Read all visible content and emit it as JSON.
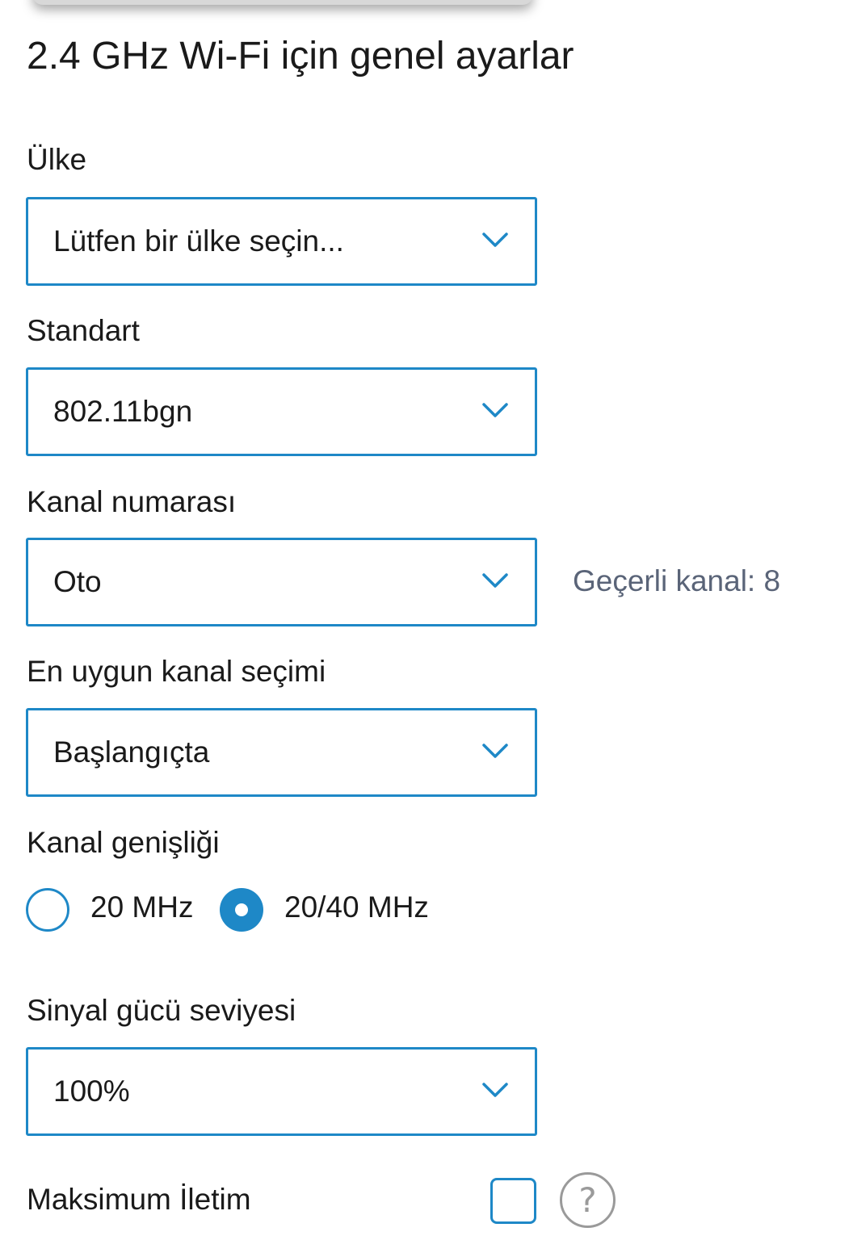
{
  "page": {
    "title": "2.4 GHz Wi-Fi için genel ayarlar"
  },
  "country": {
    "label": "Ülke",
    "value": "Lütfen bir ülke seçin...",
    "icon": "chevron-down-icon"
  },
  "standard": {
    "label": "Standart",
    "value": "802.11bgn",
    "icon": "chevron-down-icon"
  },
  "channel_number": {
    "label": "Kanal numarası",
    "value": "Oto",
    "icon": "chevron-down-icon",
    "current_channel_text": "Geçerli kanal: 8"
  },
  "optimal_channel": {
    "label": "En uygun kanal seçimi",
    "value": "Başlangıçta",
    "icon": "chevron-down-icon"
  },
  "channel_width": {
    "label": "Kanal genişliği",
    "options": [
      {
        "label": "20 MHz",
        "selected": false
      },
      {
        "label": "20/40 MHz",
        "selected": true
      }
    ]
  },
  "signal_strength": {
    "label": "Sinyal gücü seviyesi",
    "value": "100%",
    "icon": "chevron-down-icon"
  },
  "max_transmission": {
    "label": "Maksimum İletim",
    "checked": false,
    "help_icon": "question-mark-icon",
    "help_glyph": "?"
  },
  "colors": {
    "accent": "#1e88c7",
    "secondary_text": "#5a6478",
    "help_gray": "#9a9a9a"
  }
}
